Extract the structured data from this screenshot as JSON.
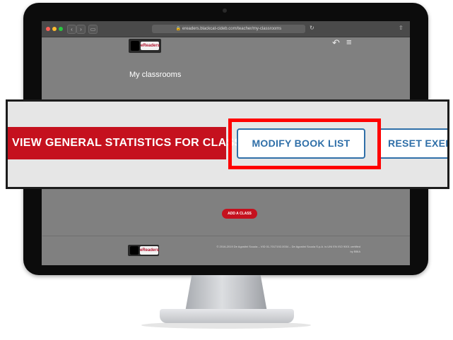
{
  "browser": {
    "url": "🔒 ereaders.blackcat-cideb.com/teacher/my-classrooms",
    "back_glyph": "‹",
    "forward_glyph": "›",
    "sidebar_glyph": "▭",
    "reload_glyph": "↻",
    "share_glyph": "⇧"
  },
  "header": {
    "logo_text": "eReaders",
    "back_icon_glyph": "↶",
    "menu_icon_glyph": "≡"
  },
  "main": {
    "title": "My classrooms",
    "add_class_label": "ADD A CLASS"
  },
  "footer": {
    "logo_text": "eReaders",
    "copyright": "© 2016-2019 De Agostini Scuola – VID 01-7017192-0034 – De Agostini Scuola S.p.A. is UNI EN ISO 9001 certified",
    "credit": "by BBIA"
  },
  "callout": {
    "view_stats_label": "VIEW GENERAL STATISTICS FOR CLASS",
    "modify_book_list_label": "MODIFY BOOK LIST",
    "reset_label": "RESET EXERC"
  },
  "colors": {
    "brand_red": "#c5111e",
    "link_blue": "#2f6fa8",
    "highlight_red": "#ff0000"
  }
}
